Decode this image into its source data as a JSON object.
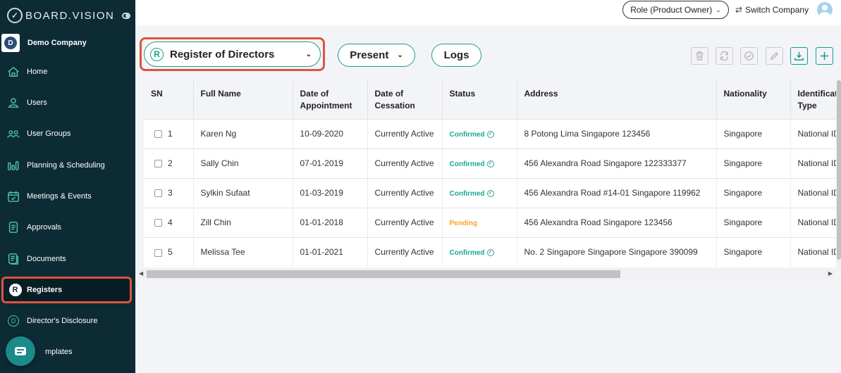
{
  "brand": {
    "name": "BOARD.VISION"
  },
  "company": {
    "initial": "D",
    "name": "Demo Company"
  },
  "sidebar": {
    "items": [
      {
        "label": "Home",
        "icon": "home-icon"
      },
      {
        "label": "Users",
        "icon": "user-icon"
      },
      {
        "label": "User Groups",
        "icon": "user-group-icon"
      },
      {
        "label": "Planning & Scheduling",
        "icon": "bar-chart-icon"
      },
      {
        "label": "Meetings & Events",
        "icon": "calendar-icon"
      },
      {
        "label": "Approvals",
        "icon": "approval-doc-icon"
      },
      {
        "label": "Documents",
        "icon": "documents-icon"
      },
      {
        "label": "Registers",
        "icon": "registers-icon",
        "badge": "R"
      },
      {
        "label": "Director's Disclosure",
        "icon": "disclosure-icon",
        "badge": "D"
      },
      {
        "label": "mplates",
        "icon": "templates-icon"
      }
    ]
  },
  "topbar": {
    "role_label": "Role (Product Owner)",
    "switch_label": "Switch Company"
  },
  "toolbar": {
    "register_badge": "R",
    "register_label": "Register of Directors",
    "present_label": "Present",
    "logs_label": "Logs",
    "tools": [
      "delete-icon",
      "refresh-icon",
      "approve-icon",
      "edit-icon",
      "download-icon",
      "add-icon"
    ]
  },
  "table": {
    "headers": [
      "SN",
      "Full Name",
      "Date of Appointment",
      "Date of Cessation",
      "Status",
      "Address",
      "Nationality",
      "Identificat Type"
    ],
    "rows": [
      {
        "sn": "1",
        "name": "Karen Ng",
        "appointment": "10-09-2020",
        "cessation": "Currently Active",
        "status": "Confirmed",
        "address": "8 Potong Lima Singapore 123456",
        "nationality": "Singapore",
        "id_type": "National ID"
      },
      {
        "sn": "2",
        "name": "Sally Chin",
        "appointment": "07-01-2019",
        "cessation": "Currently Active",
        "status": "Confirmed",
        "address": "456 Alexandra Road Singapore 122333377",
        "nationality": "Singapore",
        "id_type": "National ID"
      },
      {
        "sn": "3",
        "name": "Sylkin Sufaat",
        "appointment": "01-03-2019",
        "cessation": "Currently Active",
        "status": "Confirmed",
        "address": "456 Alexandra Road #14-01 Singapore 119962",
        "nationality": "Singapore",
        "id_type": "National ID"
      },
      {
        "sn": "4",
        "name": "Zill Chin",
        "appointment": "01-01-2018",
        "cessation": "Currently Active",
        "status": "Pending",
        "address": "456 Alexandra Road Singapore 123456",
        "nationality": "Singapore",
        "id_type": "National ID"
      },
      {
        "sn": "5",
        "name": "Melissa Tee",
        "appointment": "01-01-2021",
        "cessation": "Currently Active",
        "status": "Confirmed",
        "address": "No. 2 Singapore Singapore Singapore 390099",
        "nationality": "Singapore",
        "id_type": "National ID"
      }
    ]
  },
  "colors": {
    "sidebar_bg": "#0d2b35",
    "accent_teal": "#1a9c8b",
    "highlight_red": "#e0533d",
    "status_confirmed": "#1aa88f",
    "status_pending": "#f5a623"
  }
}
